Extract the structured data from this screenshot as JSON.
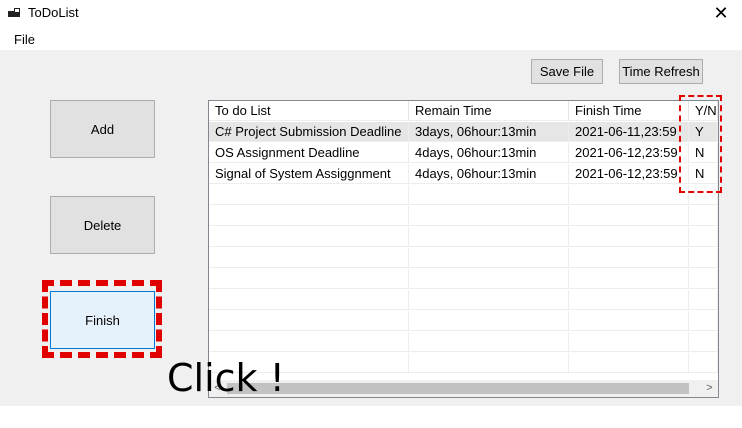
{
  "window": {
    "title": "ToDoList",
    "close_glyph": "✕"
  },
  "menu": {
    "file_label": "File"
  },
  "buttons": {
    "add": "Add",
    "delete": "Delete",
    "finish": "Finish",
    "save_file": "Save File",
    "time_refresh": "Time Refresh"
  },
  "table": {
    "columns": [
      "To do List",
      "Remain Time",
      "Finish Time",
      "Y/N"
    ],
    "rows": [
      [
        "C# Project Submission Deadline",
        "3days, 06hour:13min",
        "2021-06-11,23:59",
        "Y"
      ],
      [
        "OS Assignment Deadline",
        "4days, 06hour:13min",
        "2021-06-12,23:59",
        "N"
      ],
      [
        "Signal of System Assiggnment",
        "4days, 06hour:13min",
        "2021-06-12,23:59",
        "N"
      ]
    ],
    "scroll_left_glyph": "<",
    "scroll_right_glyph": ">"
  },
  "annotation": {
    "click_text": "Click !",
    "highlight_color": "#e00000"
  },
  "icons": {
    "app": "app-window-icon",
    "close": "close-icon"
  }
}
